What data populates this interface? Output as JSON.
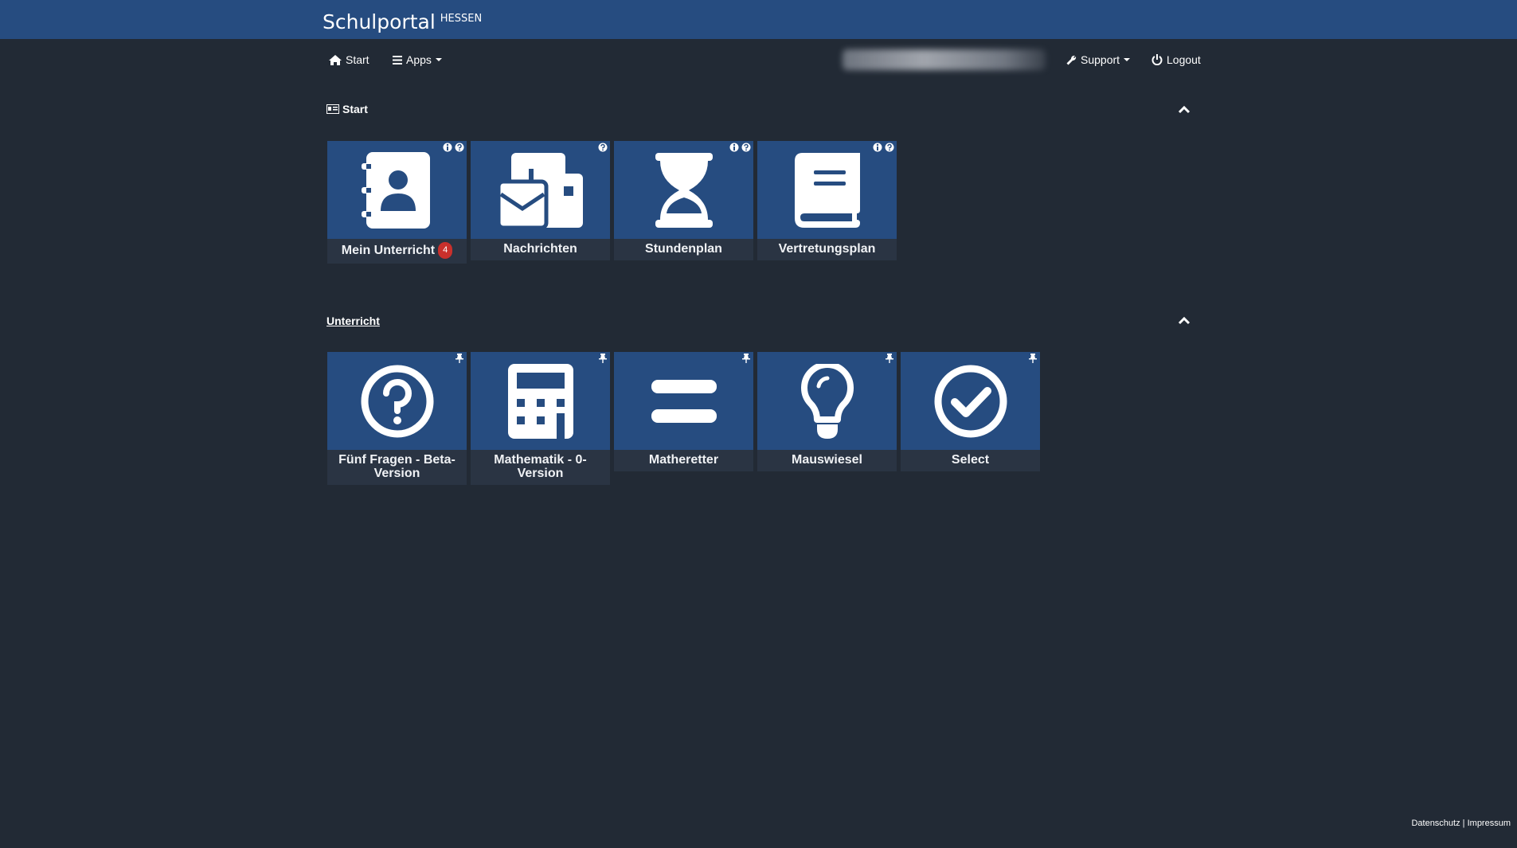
{
  "brand": {
    "main": "Schulportal",
    "sub": "HESSEN"
  },
  "nav": {
    "start": "Start",
    "apps": "Apps",
    "support": "Support",
    "logout": "Logout"
  },
  "sections": {
    "start": {
      "title": "Start"
    },
    "unterricht": {
      "title": "Unterricht"
    }
  },
  "start_tiles": [
    {
      "label": "Mein Unterricht",
      "badge": "4",
      "icon": "address-book-icon"
    },
    {
      "label": "Nachrichten",
      "icon": "envelope-card-icon"
    },
    {
      "label": "Stundenplan",
      "icon": "hourglass-icon"
    },
    {
      "label": "Vertretungsplan",
      "icon": "book-icon"
    }
  ],
  "unterricht_tiles": [
    {
      "label": "Fünf Fragen - Beta-Version",
      "icon": "question-circle-icon"
    },
    {
      "label": "Mathematik - 0-Version",
      "icon": "calculator-icon"
    },
    {
      "label": "Matheretter",
      "icon": "equals-icon"
    },
    {
      "label": "Mauswiesel",
      "icon": "lightbulb-icon"
    },
    {
      "label": "Select",
      "icon": "check-circle-icon"
    }
  ],
  "footer": {
    "privacy": "Datenschutz",
    "separator": "|",
    "imprint": "Impressum"
  },
  "colors": {
    "background": "#222a35",
    "header": "#264c80",
    "tile": "#264c80",
    "badge": "#c9302c"
  }
}
